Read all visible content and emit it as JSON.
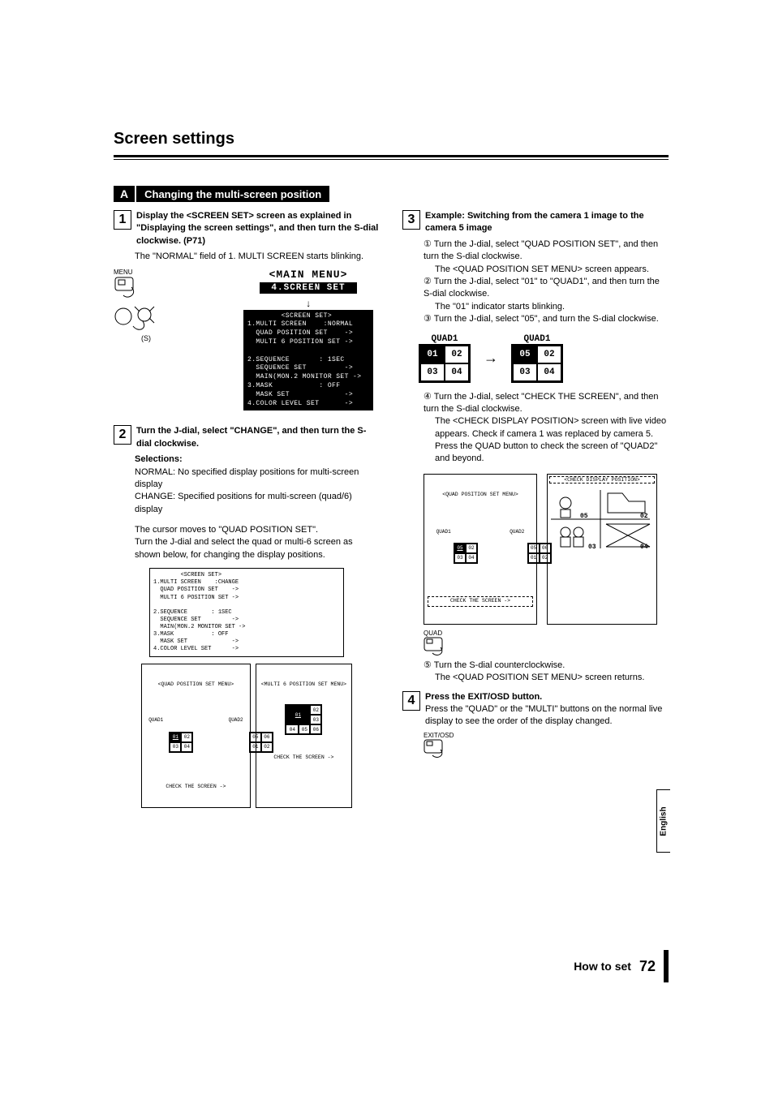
{
  "page_title": "Screen settings",
  "section": {
    "letter": "A",
    "title": "Changing the multi-screen position"
  },
  "step1": {
    "num": "1",
    "bold": "Display the <SCREEN SET> screen as explained in \"Displaying the screen settings\", and then turn the S-dial clockwise. (P71)",
    "text": "The \"NORMAL\" field of 1. MULTI SCREEN starts blinking."
  },
  "menu_label": "MENU",
  "s_label": "(S)",
  "main_menu_title": "<MAIN MENU>",
  "screen_set_item": "4.SCREEN SET",
  "osd_screen_set": "        <SCREEN SET>\n1.MULTI SCREEN    :NORMAL\n  QUAD POSITION SET    ->\n  MULTI 6 POSITION SET ->\n\n2.SEQUENCE       : 1SEC\n  SEQUENCE SET         ->\n  MAIN(MON.2 MONITOR SET ->\n3.MASK           : OFF\n  MASK SET             ->\n4.COLOR LEVEL SET      ->",
  "step2": {
    "num": "2",
    "bold": "Turn the J-dial, select \"CHANGE\", and then turn the S-dial clockwise.",
    "selections_label": "Selections:",
    "normal_label": "NORMAL:",
    "normal_text": " No specified display positions for multi-screen display",
    "change_label": "CHANGE:",
    "change_text": " Specified positions for multi-screen (quad/6) display",
    "para1": "The cursor moves to \"QUAD POSITION SET\".",
    "para2": "Turn the J-dial and select the quad or multi-6 screen as shown below, for changing the display positions."
  },
  "flow_panel": "        <SCREEN SET>\n1.MULTI SCREEN    :CHANGE\n  QUAD POSITION SET    ->\n  MULTI 6 POSITION SET ->\n\n2.SEQUENCE       : 1SEC\n  SEQUENCE SET         ->\n  MAIN(MON.2 MONITOR SET ->\n3.MASK           : OFF\n  MASK SET             ->\n4.COLOR LEVEL SET      ->",
  "flow_quad_title": "<QUAD POSITION SET MENU>",
  "flow_quad_label1": "QUAD1",
  "flow_quad_label2": "QUAD2",
  "flow_quad_check": "CHECK THE SCREEN ->",
  "flow_multi6_title": "<MULTI 6 POSITION SET MENU>",
  "flow_multi6_check": "CHECK THE SCREEN ->",
  "flow_q1": [
    "01",
    "02",
    "03",
    "04"
  ],
  "flow_q2": [
    "05",
    "06",
    "01",
    "02"
  ],
  "flow_m6": [
    "01",
    "02",
    "03",
    "04",
    "05",
    "06"
  ],
  "step3": {
    "num": "3",
    "bold": "Example: Switching from the camera 1 image to the camera 5 image",
    "c1_bold": "Turn the J-dial, select \"QUAD POSITION SET\", and then turn the S-dial clockwise.",
    "c1_text": "The <QUAD POSITION SET MENU> screen appears.",
    "c2_bold": "Turn the J-dial, select \"01\" to \"QUAD1\", and then turn the S-dial clockwise.",
    "c2_text": "The \"01\" indicator starts blinking.",
    "c3_bold": "Turn the J-dial, select \"05\", and turn the S-dial clockwise.",
    "c4_bold": "Turn the J-dial, select \"CHECK THE SCREEN\", and then turn the S-dial clockwise.",
    "c4_text1": "The <CHECK DISPLAY POSITION> screen with live video appears. Check if camera 1 was replaced by camera 5.",
    "c4_text2": "Press the QUAD button to check the screen of \"QUAD2\" and beyond.",
    "c5_bold": "Turn the S-dial counterclockwise.",
    "c5_text": "The <QUAD POSITION SET MENU> screen returns."
  },
  "quad1_label": "QUAD1",
  "quad_before": [
    "01",
    "02",
    "03",
    "04"
  ],
  "quad_after": [
    "05",
    "02",
    "03",
    "04"
  ],
  "check_panel1_title": "<QUAD POSITION SET MENU>",
  "check_panel1_labels": {
    "q1": "QUAD1",
    "q2": "QUAD2"
  },
  "check_panel1_q1": [
    "05",
    "02",
    "03",
    "04"
  ],
  "check_panel1_q2": [
    "05",
    "06",
    "01",
    "02"
  ],
  "check_panel1_footer": "CHECK THE SCREEN ->",
  "check_panel2_title": "<CHECK DISPLAY POSITION>",
  "check_panel2_cells": [
    "05",
    "02",
    "03",
    "04"
  ],
  "quad_btn_label": "QUAD",
  "step4": {
    "num": "4",
    "bold": "Press the EXIT/OSD button.",
    "text": "Press the \"QUAD\" or the \"MULTI\" buttons on the normal live display to see the order of the display changed."
  },
  "exit_label": "EXIT/OSD",
  "footer": {
    "howto": "How to set",
    "page": "72"
  },
  "lang": "English",
  "circled": {
    "c1": "①",
    "c2": "②",
    "c3": "③",
    "c4": "④",
    "c5": "⑤"
  }
}
